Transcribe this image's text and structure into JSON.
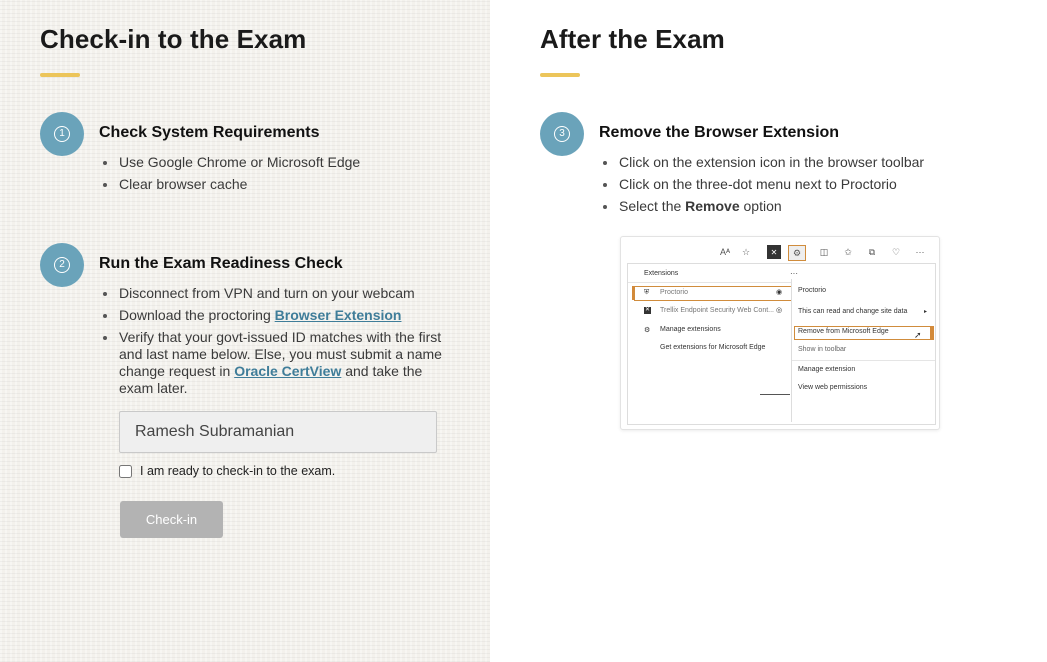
{
  "checkin": {
    "title": "Check-in to the Exam",
    "step1": {
      "number": "1",
      "title": "Check System Requirements",
      "bullets": [
        "Use Google Chrome or Microsoft Edge",
        "Clear browser cache"
      ]
    },
    "step2": {
      "number": "2",
      "title": "Run the Exam Readiness Check",
      "bullet1": "Disconnect from VPN and turn on your webcam",
      "bullet2_prefix": "Download the proctoring ",
      "bullet2_link": "Browser Extension",
      "bullet3_prefix": "Verify that your govt-issued ID matches with the first and last name below. Else, you must submit a name change request in ",
      "bullet3_link": "Oracle CertView",
      "bullet3_suffix": " and take the exam later."
    },
    "name_value": "Ramesh Subramanian",
    "ready_label": "I am ready to check-in to the exam.",
    "checkin_button": "Check-in"
  },
  "after": {
    "title": "After the Exam",
    "step3": {
      "number": "3",
      "title": "Remove the Browser Extension",
      "bullet1": "Click on the extension icon in the browser toolbar",
      "bullet2": "Click on the three-dot menu next to Proctorio",
      "bullet3_prefix": "Select the ",
      "bullet3_bold": "Remove",
      "bullet3_suffix": " option"
    }
  },
  "screenshot": {
    "toolbar_text": "Aᴬ",
    "panel_title": "Extensions",
    "ext_proctorio": "Proctorio",
    "ext_trellix": "Trellix Endpoint Security Web Cont...",
    "manage_extensions": "Manage extensions",
    "get_extensions": "Get extensions for Microsoft Edge",
    "menu_header": "Proctorio",
    "menu_site_data": "This can read and change site data",
    "menu_remove": "Remove from Microsoft Edge",
    "menu_show": "Show in toolbar",
    "menu_manage": "Manage extension",
    "menu_permissions": "View web permissions",
    "more_glyph": "···"
  },
  "colors": {
    "accent": "#ecc55a",
    "badge": "#6aa3ba",
    "link": "#3f7d99",
    "highlight": "#d38a3a"
  }
}
